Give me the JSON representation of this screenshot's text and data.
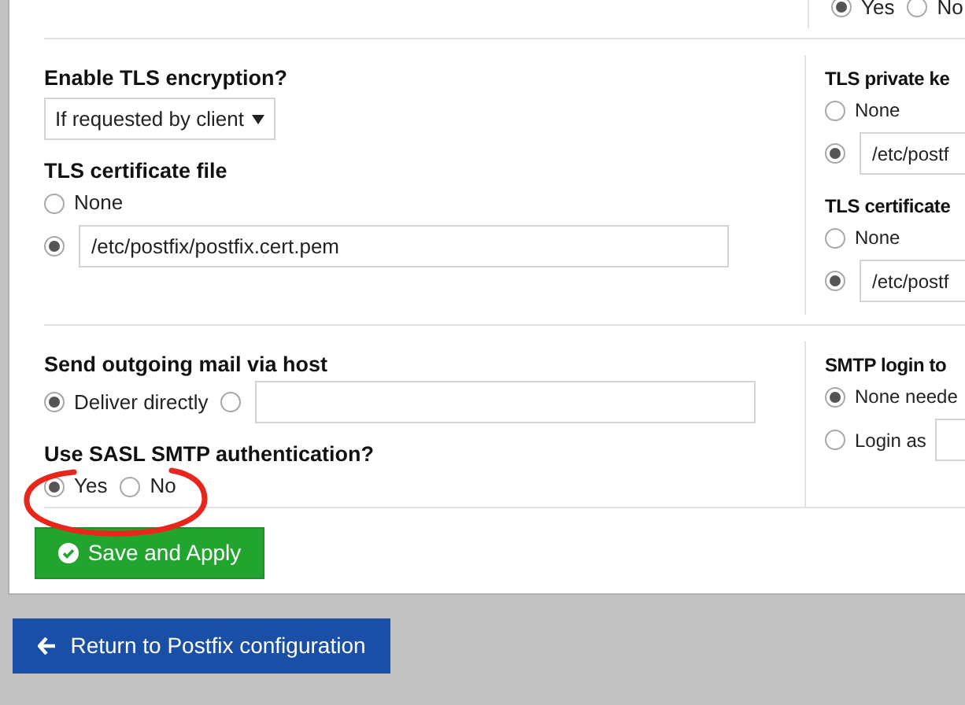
{
  "top_row": {
    "options": [
      {
        "label": "Yes",
        "selected": true
      },
      {
        "label": "No",
        "selected": false
      }
    ]
  },
  "sections": [
    {
      "left": [
        {
          "kind": "select",
          "label": "Enable TLS encryption?",
          "value": "If requested by client"
        },
        {
          "kind": "radios",
          "label": "TLS certificate file",
          "inline": false,
          "options": [
            {
              "kind": "text",
              "label": "None",
              "selected": false
            },
            {
              "kind": "input",
              "value": "/etc/postfix/postfix.cert.pem",
              "selected": true
            }
          ]
        }
      ],
      "right": [
        {
          "kind": "radios",
          "label": "TLS private ke",
          "inline": false,
          "options": [
            {
              "kind": "text",
              "label": "None",
              "selected": false
            },
            {
              "kind": "input",
              "value": "/etc/postf",
              "selected": true
            }
          ]
        },
        {
          "kind": "radios",
          "label": "TLS certificate",
          "inline": false,
          "options": [
            {
              "kind": "text",
              "label": "None",
              "selected": false
            },
            {
              "kind": "input",
              "value": "/etc/postf",
              "selected": true
            }
          ]
        }
      ]
    },
    {
      "left": [
        {
          "kind": "radios",
          "label": "Send outgoing mail via host",
          "inline": true,
          "options": [
            {
              "kind": "text",
              "label": "Deliver directly",
              "selected": true
            },
            {
              "kind": "input",
              "selected": false
            }
          ]
        },
        {
          "kind": "radios",
          "label": "Use SASL SMTP authentication?",
          "inline": true,
          "options": [
            {
              "kind": "text",
              "label": "Yes",
              "selected": true
            },
            {
              "kind": "text",
              "label": "No",
              "selected": false
            }
          ]
        }
      ],
      "right": [
        {
          "kind": "radios",
          "label": "SMTP login to",
          "inline": false,
          "options": [
            {
              "kind": "text",
              "label": "None neede",
              "selected": true
            },
            {
              "kind": "text_input",
              "label": "Login as",
              "selected": false
            }
          ]
        }
      ]
    }
  ],
  "save_button": "Save and Apply",
  "return_button": "Return to Postfix configuration"
}
